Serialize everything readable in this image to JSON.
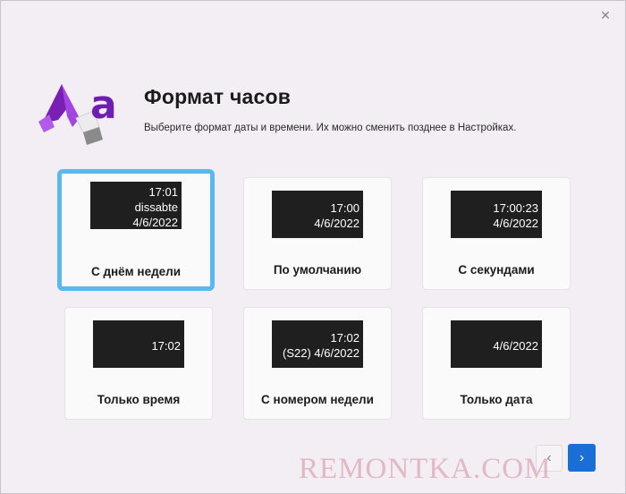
{
  "window": {
    "close_icon": "close-icon"
  },
  "header": {
    "title": "Формат часов",
    "subtitle": "Выберите формат даты и времени. Их можно сменить позднее в Настройках."
  },
  "cards": [
    {
      "lines": [
        "17:01",
        "dissabte",
        "4/6/2022"
      ],
      "label": "С днём недели",
      "selected": true
    },
    {
      "lines": [
        "17:00",
        "4/6/2022"
      ],
      "label": "По умолчанию",
      "selected": false
    },
    {
      "lines": [
        "17:00:23",
        "4/6/2022"
      ],
      "label": "С секундами",
      "selected": false
    },
    {
      "lines": [
        "17:02"
      ],
      "label": "Только время",
      "selected": false
    },
    {
      "lines": [
        "17:02",
        "(S22) 4/6/2022"
      ],
      "label": "С номером недели",
      "selected": false
    },
    {
      "lines": [
        "4/6/2022"
      ],
      "label": "Только дата",
      "selected": false
    }
  ],
  "nav": {
    "prev_icon": "chevron-left-icon",
    "next_icon": "chevron-right-icon"
  },
  "watermark": "REMONTKA.COM",
  "colors": {
    "accent": "#1a6fd6",
    "selection": "#5ab8f0",
    "preview_bg": "#1e1f1e"
  }
}
